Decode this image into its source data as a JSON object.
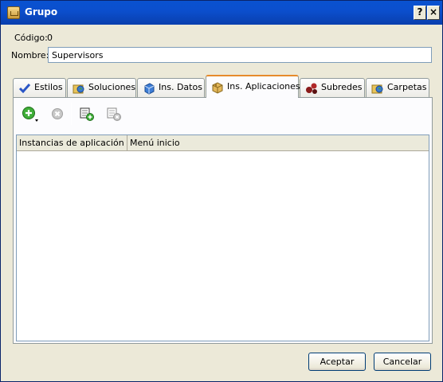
{
  "window": {
    "title": "Grupo",
    "help_label": "?",
    "close_label": "×"
  },
  "form": {
    "codigo_label": "Código:",
    "codigo_value": "0",
    "nombre_label": "Nombre:",
    "nombre_value": "Supervisors"
  },
  "tabs": [
    {
      "label": "Estilos",
      "icon": "checkmark-icon"
    },
    {
      "label": "Soluciones",
      "icon": "folder-globe-icon"
    },
    {
      "label": "Ins. Datos",
      "icon": "data-cube-icon"
    },
    {
      "label": "Ins. Aplicaciones",
      "icon": "package-icon",
      "active": true
    },
    {
      "label": "Subredes",
      "icon": "network-nodes-icon"
    },
    {
      "label": "Carpetas",
      "icon": "folder-globe-icon"
    }
  ],
  "toolbar": {
    "items": [
      "add-icon",
      "delete-icon",
      "new-item-icon",
      "remove-item-icon"
    ]
  },
  "grid": {
    "columns": [
      "Instancias de aplicación",
      "Menú inicio"
    ],
    "rows": []
  },
  "buttons": {
    "accept": "Aceptar",
    "cancel": "Cancelar"
  }
}
